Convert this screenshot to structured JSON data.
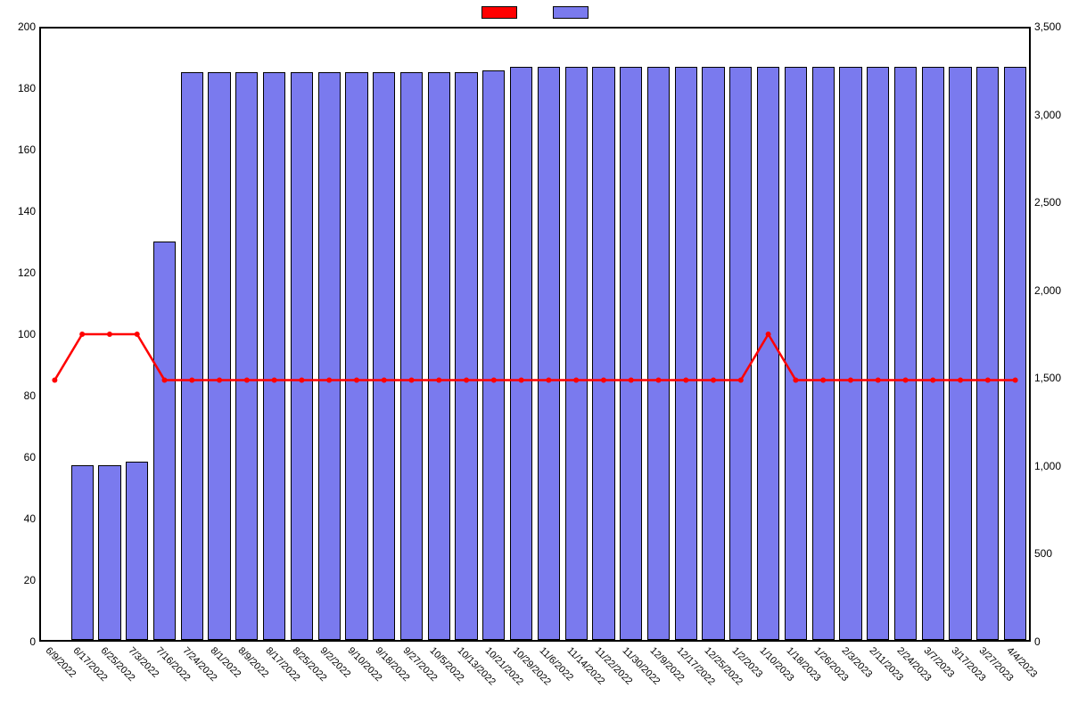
{
  "chart_data": {
    "type": "bar",
    "categories": [
      "6/9/2022",
      "6/17/2022",
      "6/25/2022",
      "7/3/2022",
      "7/16/2022",
      "7/24/2022",
      "8/1/2022",
      "8/9/2022",
      "8/17/2022",
      "8/25/2022",
      "9/2/2022",
      "9/10/2022",
      "9/18/2022",
      "9/27/2022",
      "10/5/2022",
      "10/13/2022",
      "10/21/2022",
      "10/29/2022",
      "11/6/2022",
      "11/14/2022",
      "11/22/2022",
      "11/30/2022",
      "12/9/2022",
      "12/17/2022",
      "12/25/2022",
      "1/2/2023",
      "1/10/2023",
      "1/18/2023",
      "1/26/2023",
      "2/3/2023",
      "2/11/2023",
      "2/24/2023",
      "3/7/2023",
      "3/17/2023",
      "3/27/2023",
      "4/4/2023"
    ],
    "series": [
      {
        "name": "",
        "type": "line",
        "axis": "left",
        "color": "#ff0000",
        "values": [
          85,
          100,
          100,
          100,
          85,
          85,
          85,
          85,
          85,
          85,
          85,
          85,
          85,
          85,
          85,
          85,
          85,
          85,
          85,
          85,
          85,
          85,
          85,
          85,
          85,
          85,
          100,
          85,
          85,
          85,
          85,
          85,
          85,
          85,
          85,
          85
        ]
      },
      {
        "name": "",
        "type": "bar",
        "axis": "right",
        "color": "#7a7aee",
        "values": [
          0,
          1000,
          1000,
          1020,
          2280,
          3250,
          3250,
          3250,
          3250,
          3250,
          3250,
          3250,
          3250,
          3250,
          3250,
          3250,
          3260,
          3280,
          3280,
          3280,
          3280,
          3280,
          3280,
          3280,
          3280,
          3280,
          3280,
          3280,
          3280,
          3280,
          3280,
          3280,
          3280,
          3280,
          3280,
          3280
        ]
      }
    ],
    "y_left": {
      "min": 0,
      "max": 200,
      "ticks": [
        0,
        20,
        40,
        60,
        80,
        100,
        120,
        140,
        160,
        180,
        200
      ]
    },
    "y_right": {
      "min": 0,
      "max": 3500,
      "ticks": [
        0,
        500,
        1000,
        1500,
        2000,
        2500,
        3000,
        3500
      ]
    },
    "legend": {
      "items": [
        {
          "color": "#ff0000"
        },
        {
          "color": "#7a7aee"
        }
      ]
    }
  },
  "colors": {
    "line": "#ff0000",
    "bar": "#7a7aee",
    "axis": "#000000"
  }
}
